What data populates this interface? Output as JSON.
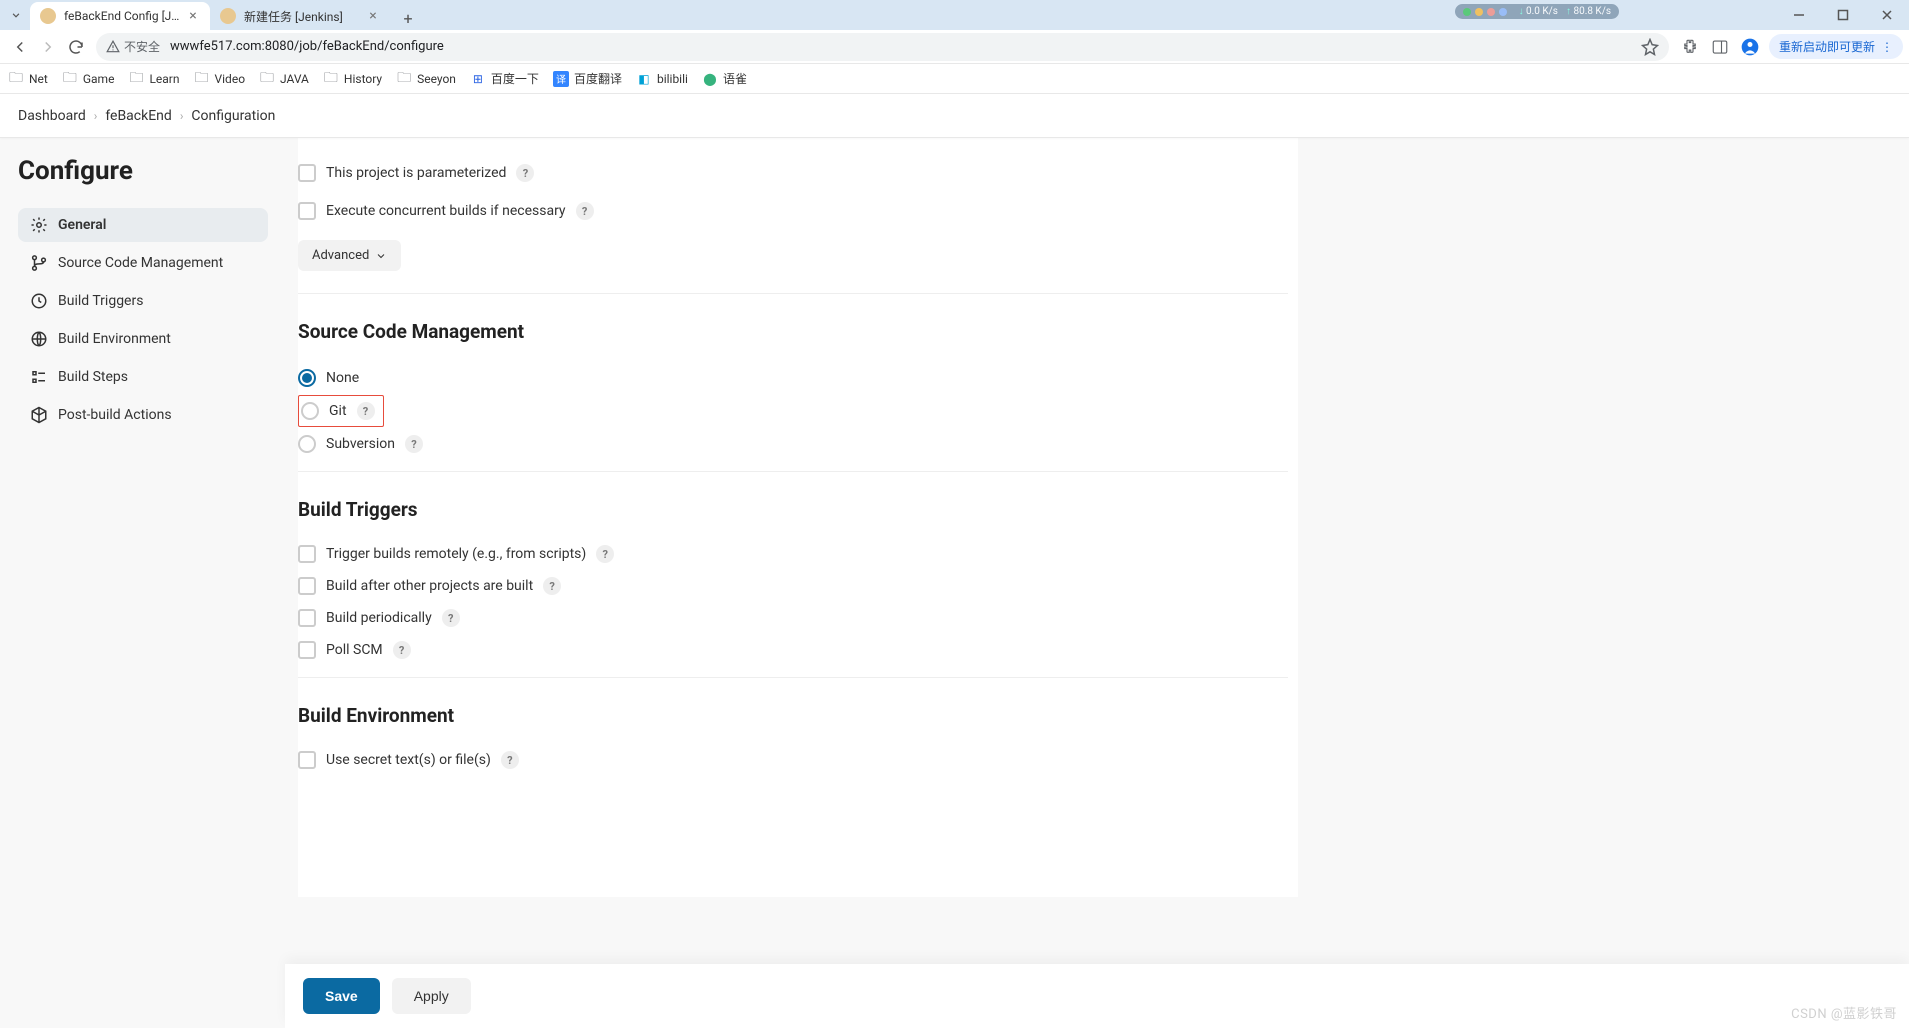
{
  "browser": {
    "tabs": [
      {
        "title": "feBackEnd Config [Jenkins]",
        "active": true
      },
      {
        "title": "新建任务 [Jenkins]",
        "active": false
      }
    ],
    "url_security": "不安全",
    "url": "wwwfe517.com:8080/job/feBackEnd/configure",
    "update_label": "重新启动即可更新",
    "bookmarks": [
      {
        "label": "Net",
        "type": "folder"
      },
      {
        "label": "Game",
        "type": "folder"
      },
      {
        "label": "Learn",
        "type": "folder"
      },
      {
        "label": "Video",
        "type": "folder"
      },
      {
        "label": "JAVA",
        "type": "folder"
      },
      {
        "label": "History",
        "type": "folder"
      },
      {
        "label": "Seeyon",
        "type": "folder"
      },
      {
        "label": "百度一下",
        "type": "site_baidu"
      },
      {
        "label": "百度翻译",
        "type": "site_bdfy"
      },
      {
        "label": "bilibili",
        "type": "site_bili"
      },
      {
        "label": "语雀",
        "type": "site_yuque"
      }
    ],
    "speed_down": "0.0 K/s",
    "speed_up": "80.8 K/s"
  },
  "breadcrumb": {
    "items": [
      "Dashboard",
      "feBackEnd",
      "Configuration"
    ]
  },
  "sidebar": {
    "title": "Configure",
    "items": [
      {
        "label": "General"
      },
      {
        "label": "Source Code Management"
      },
      {
        "label": "Build Triggers"
      },
      {
        "label": "Build Environment"
      },
      {
        "label": "Build Steps"
      },
      {
        "label": "Post-build Actions"
      }
    ]
  },
  "general": {
    "parameterized": "This project is parameterized",
    "concurrent": "Execute concurrent builds if necessary",
    "advanced": "Advanced"
  },
  "scm": {
    "heading": "Source Code Management",
    "none": "None",
    "git": "Git",
    "svn": "Subversion"
  },
  "triggers": {
    "heading": "Build Triggers",
    "remote": "Trigger builds remotely (e.g., from scripts)",
    "after": "Build after other projects are built",
    "periodic": "Build periodically",
    "poll": "Poll SCM"
  },
  "env": {
    "heading": "Build Environment",
    "secret": "Use secret text(s) or file(s)"
  },
  "buttons": {
    "save": "Save",
    "apply": "Apply"
  },
  "watermark": "CSDN @蓝影铁哥"
}
